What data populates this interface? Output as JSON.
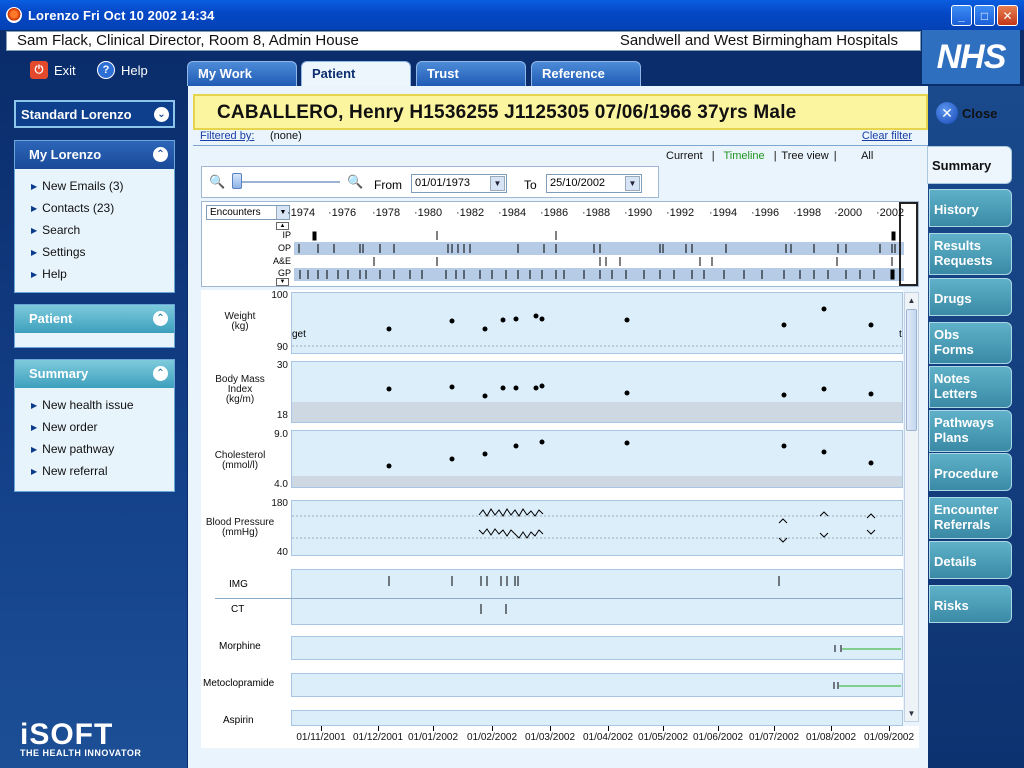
{
  "window": {
    "title": "Lorenzo Fri Oct 10 2002 14:34"
  },
  "header": {
    "user": "Sam Flack, Clinical Director, Room 8, Admin House",
    "hospital": "Sandwell and West Birmingham Hospitals",
    "brand": "NHS"
  },
  "topactions": {
    "exit": "Exit",
    "help": "Help"
  },
  "leftnav": {
    "standard": "Standard Lorenzo",
    "mylorenzo": {
      "title": "My Lorenzo",
      "items": [
        "New Emails (3)",
        "Contacts (23)",
        "Search",
        "Settings",
        "Help"
      ]
    },
    "patient": {
      "title": "Patient"
    },
    "summary": {
      "title": "Summary",
      "items": [
        "New health issue",
        "New order",
        "New pathway",
        "New referral"
      ]
    },
    "logo": "iSOFT",
    "tagline": "THE HEALTH INNOVATOR"
  },
  "tabs": [
    "My Work",
    "Patient",
    "Trust",
    "Reference"
  ],
  "patient": {
    "banner": "CABALLERO, Henry  H1536255  J1125305  07/06/1966  37yrs  Male"
  },
  "filter": {
    "label": "Filtered by:",
    "value": "(none)",
    "clear": "Clear filter"
  },
  "views": {
    "current": "Current",
    "timeline": "Timeline",
    "tree": "Tree view",
    "all": "All"
  },
  "range": {
    "from_label": "From",
    "from": "01/01/1973",
    "to_label": "To",
    "to": "25/10/2002"
  },
  "overview": {
    "selector": "Encounters",
    "years": [
      "1974",
      "1976",
      "1978",
      "1980",
      "1982",
      "1984",
      "1986",
      "1988",
      "1990",
      "1992",
      "1994",
      "1996",
      "1998",
      "2000",
      "2002"
    ],
    "rows": [
      "IP",
      "OP",
      "A&E",
      "GP"
    ]
  },
  "graphs": {
    "weight": {
      "label": "Weight\n(kg)",
      "max": "100",
      "min": "90",
      "note": "get",
      "note2": "t"
    },
    "bmi": {
      "label": "Body Mass\nIndex\n(kg/m)",
      "max": "30",
      "min": "18"
    },
    "chol": {
      "label": "Cholesterol\n(mmol/l)",
      "max": "9.0",
      "min": "4.0"
    },
    "bp": {
      "label": "Blood Pressure\n(mmHg)",
      "max": "180",
      "min": "40"
    },
    "img": "IMG",
    "ct": "CT",
    "morphine": "Morphine",
    "metoclopramide": "Metoclopramide",
    "aspirin": "Aspirin"
  },
  "bottomdates": [
    "01/11/2001",
    "01/12/2001",
    "01/01/2002",
    "01/02/2002",
    "01/03/2002",
    "01/04/2002",
    "01/05/2002",
    "01/06/2002",
    "01/07/2002",
    "01/08/2002",
    "01/09/2002"
  ],
  "righttabs": {
    "close": "Close",
    "items": [
      "Summary",
      "History",
      "Results\nRequests",
      "Drugs",
      "Obs\nForms",
      "Notes\nLetters",
      "Pathways\nPlans",
      "Procedure",
      "Encounter\nReferrals",
      "Details",
      "Risks"
    ]
  }
}
